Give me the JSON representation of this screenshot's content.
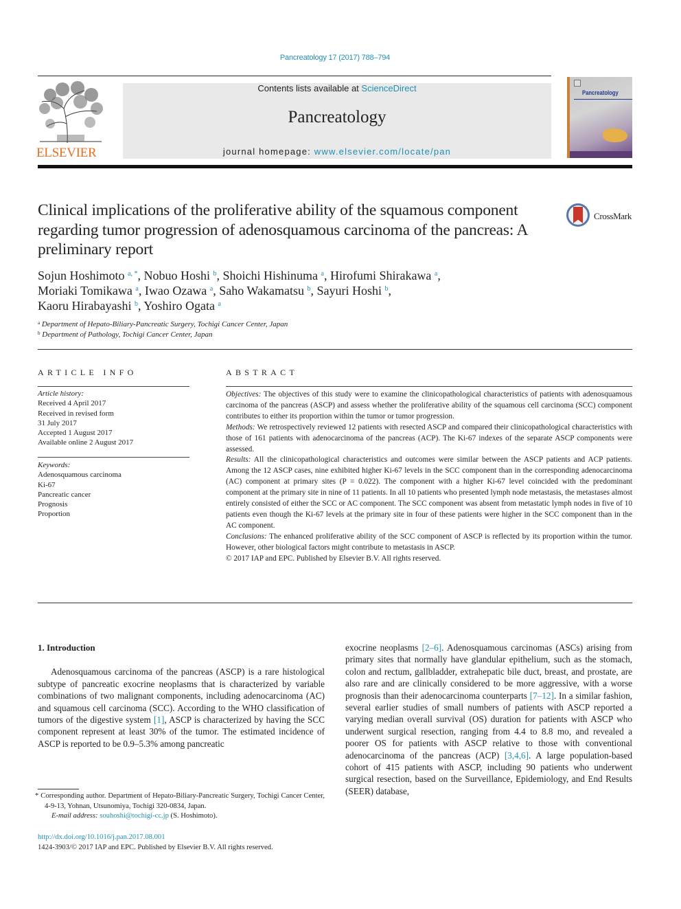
{
  "running_head": "Pancreatology 17 (2017) 788–794",
  "masthead": {
    "publisher_logo_text": "ELSEVIER",
    "contents_prefix": "Contents lists available at ",
    "contents_link": "ScienceDirect",
    "journal_name": "Pancreatology",
    "homepage_prefix": "journal homepage: ",
    "homepage_link": "www.elsevier.com/locate/pan",
    "cover_title": "Pancreatology",
    "colors": {
      "link": "#1f8fb6",
      "elsevier_orange": "#e9711c",
      "banner_bg": "#e9e9e9"
    }
  },
  "article": {
    "title": "Clinical implications of the proliferative ability of the squamous component regarding tumor progression of adenosquamous carcinoma of the pancreas: A preliminary report",
    "crossmark_label": "CrossMark",
    "authors": [
      {
        "name": "Sojun Hoshimoto",
        "sup": "a, *",
        "sep": ", "
      },
      {
        "name": "Nobuo Hoshi",
        "sup": "b",
        "sep": ", "
      },
      {
        "name": "Shoichi Hishinuma",
        "sup": "a",
        "sep": ", "
      },
      {
        "name": "Hirofumi Shirakawa",
        "sup": "a",
        "sep": ", "
      },
      {
        "name": "Moriaki Tomikawa",
        "sup": "a",
        "sep": ", "
      },
      {
        "name": "Iwao Ozawa",
        "sup": "a",
        "sep": ", "
      },
      {
        "name": "Saho Wakamatsu",
        "sup": "b",
        "sep": ", "
      },
      {
        "name": "Sayuri Hoshi",
        "sup": "b",
        "sep": ", "
      },
      {
        "name": "Kaoru Hirabayashi",
        "sup": "b",
        "sep": ", "
      },
      {
        "name": "Yoshiro Ogata",
        "sup": "a",
        "sep": ""
      }
    ],
    "affiliations": [
      {
        "key": "a",
        "text": "Department of Hepato-Biliary-Pancreatic Surgery, Tochigi Cancer Center, Japan"
      },
      {
        "key": "b",
        "text": "Department of Pathology, Tochigi Cancer Center, Japan"
      }
    ]
  },
  "article_info": {
    "heading": "ARTICLE INFO",
    "history_label": "Article history:",
    "history": [
      "Received 4 April 2017",
      "Received in revised form",
      "31 July 2017",
      "Accepted 1 August 2017",
      "Available online 2 August 2017"
    ],
    "keywords_label": "Keywords:",
    "keywords": [
      "Adenosquamous carcinoma",
      "Ki-67",
      "Pancreatic cancer",
      "Prognosis",
      "Proportion"
    ]
  },
  "abstract": {
    "heading": "ABSTRACT",
    "sections": [
      {
        "label": "Objectives:",
        "text": " The objectives of this study were to examine the clinicopathological characteristics of patients with adenosquamous carcinoma of the pancreas (ASCP) and assess whether the proliferative ability of the squamous cell carcinoma (SCC) component contributes to either its proportion within the tumor or tumor progression."
      },
      {
        "label": "Methods:",
        "text": " We retrospectively reviewed 12 patients with resected ASCP and compared their clinicopathological characteristics with those of 161 patients with adenocarcinoma of the pancreas (ACP). The Ki-67 indexes of the separate ASCP components were assessed."
      },
      {
        "label": "Results:",
        "text": "  All the clinicopathological characteristics and outcomes were similar between the ASCP patients and ACP patients. Among the 12 ASCP cases, nine exhibited higher Ki-67 levels in the SCC component than in the corresponding adenocarcinoma (AC) component at primary sites (P = 0.022). The component with a higher Ki-67 level coincided with the predominant component at the primary site in nine of 11 patients. In all 10 patients who presented lymph node metastasis, the metastases almost entirely consisted of either the SCC or AC component. The SCC component was absent from metastatic lymph nodes in five of 10 patients even though the Ki-67 levels at the primary site in four of these patients were higher in the SCC component than in the AC component."
      },
      {
        "label": "Conclusions:",
        "text": " The enhanced proliferative ability of the SCC component of ASCP is reflected by its proportion within the tumor. However, other biological factors might contribute to metastasis in ASCP."
      }
    ],
    "copyright": "© 2017 IAP and EPC. Published by Elsevier B.V. All rights reserved."
  },
  "body": {
    "intro_heading": "1.  Introduction",
    "left_text_1": "Adenosquamous carcinoma of the pancreas (ASCP) is a rare histological subtype of pancreatic exocrine neoplasms that is characterized by variable combinations of two malignant components, including adenocarcinoma (AC) and squamous cell carcinoma (SCC). According to the WHO classification of tumors of the digestive system ",
    "left_ref_1": "[1]",
    "left_text_2": ", ASCP is characterized by having the SCC component represent at least 30% of the tumor. The estimated incidence of ASCP is reported to be 0.9–5.3% among pancreatic",
    "right_text_1": "exocrine neoplasms ",
    "right_ref_1": "[2–6]",
    "right_text_2": ". Adenosquamous carcinomas (ASCs) arising from primary sites that normally have glandular epithelium, such as the stomach, colon and rectum, gallbladder, extrahepatic bile duct, breast, and prostate, are also rare and are clinically considered to be more aggressive, with a worse prognosis than their adenocarcinoma counterparts ",
    "right_ref_2": "[7–12]",
    "right_text_3": ". In a similar fashion, several earlier studies of small numbers of patients with ASCP reported a varying median overall survival (OS) duration for patients with ASCP who underwent surgical resection, ranging from 4.4 to 8.8 mo, and revealed a poorer OS for patients with ASCP relative to those with conventional adenocarcinoma of the pancreas (ACP) ",
    "right_ref_3": "[3,4,6]",
    "right_text_4": ". A large population-based cohort of 415 patients with ASCP, including 90 patients who underwent surgical resection, based on the Surveillance, Epidemiology, and End Results (SEER) database,"
  },
  "footnote": {
    "corresponding": "* Corresponding author. Department of Hepato-Biliary-Pancreatic Surgery, Tochigi Cancer Center, 4-9-13, Yohnan, Utsunomiya, Tochigi 320-0834, Japan.",
    "email_label": "E-mail address:",
    "email": "souhoshi@tochigi-cc.jp",
    "email_suffix": " (S. Hoshimoto)."
  },
  "doi": {
    "link": "http://dx.doi.org/10.1016/j.pan.2017.08.001",
    "issn_line": "1424-3903/© 2017 IAP and EPC. Published by Elsevier B.V. All rights reserved."
  }
}
